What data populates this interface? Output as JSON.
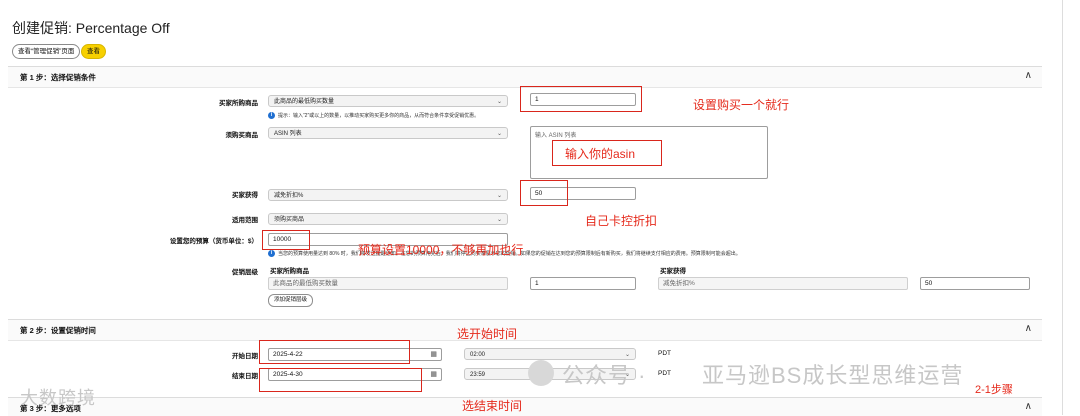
{
  "page": {
    "title": "创建促销: Percentage Off",
    "pills": [
      "查看“管理促销”页面",
      "查看"
    ]
  },
  "step1": {
    "header": "第 1 步：选择促销条件",
    "buyer_purchases_label": "买家所购商品",
    "buyer_purchases_select": "此商品的最低购买数量",
    "buyer_purchases_value": "1",
    "buyer_purchases_hint": "提示：输入“2”或以上的数量，以推动买家购买更多你的商品，从而符合条件享受促销优惠。",
    "purchased_items_label": "须购买商品",
    "purchased_items_select": "ASIN 列表",
    "asin_placeholder": "输入 ASIN 列表",
    "buyer_gets_label": "买家获得",
    "buyer_gets_select": "减免折扣%",
    "buyer_gets_value": "50",
    "applies_to_label": "适用范围",
    "applies_to_select": "须购买商品",
    "budget_label": "设置您的预算（货币单位：$）",
    "budget_value": "10000",
    "budget_hint": "当您的预算使用量达到 80% 时，我们将发送提醒通知。在您的预算用完后，我们将停止向买家展示您的促销。如果您的促销在达到您的预算限制后有新购买，我们将继续支付相应的费用。预算限制可能会超出。",
    "tiers_label": "促销层级",
    "tiers_col_buy": "买家所购商品",
    "tiers_col_get": "买家获得",
    "tier_row_select": "此商品的最低购买数量",
    "tier_row_qty": "1",
    "tier_row_get_select": "减免折扣%",
    "tier_row_get_value": "50",
    "add_tier_button": "添加促销层级"
  },
  "step2": {
    "header": "第 2 步：设置促销时间",
    "start_label": "开始日期",
    "start_date": "2025-4-22",
    "start_time": "02:00",
    "start_tz": "PDT",
    "end_label": "结束日期",
    "end_date": "2025-4-30",
    "end_time": "23:59",
    "end_tz": "PDT"
  },
  "step3": {
    "header": "第 3 步：更多选项"
  },
  "annotations": {
    "a1": "设置购买一个就行",
    "a2": "输入你的asin",
    "a3": "自己卡控折扣",
    "a4": "预算设置10000，不够再加也行",
    "a5": "选开始时间",
    "a6": "选结束时间",
    "a7": "2-1步骤"
  },
  "watermarks": {
    "brand": "亚马逊BS成长型思维运营",
    "public": "公众号 ·",
    "left": "大数跨境"
  },
  "colors": {
    "annotation_red": "#e52a1c",
    "pill_yellow": "#f7d000",
    "info_blue": "#1f6fd1"
  }
}
